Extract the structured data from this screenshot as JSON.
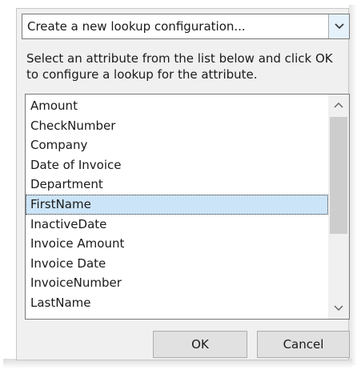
{
  "dropdown": {
    "selected": "Create a new lookup configuration..."
  },
  "instructions": "Select an attribute from the list below and click OK to configure a lookup for the attribute.",
  "attributes": [
    "Amount",
    "CheckNumber",
    "Company",
    "Date of Invoice",
    "Department",
    "FirstName",
    "InactiveDate",
    "Invoice Amount",
    "Invoice Date",
    "InvoiceNumber",
    "LastName"
  ],
  "selected_attribute": "FirstName",
  "buttons": {
    "ok": "OK",
    "cancel": "Cancel"
  },
  "icons": {
    "dropdown": "chevron-down-icon",
    "scroll_up": "chevron-up-icon",
    "scroll_down": "chevron-down-icon"
  }
}
